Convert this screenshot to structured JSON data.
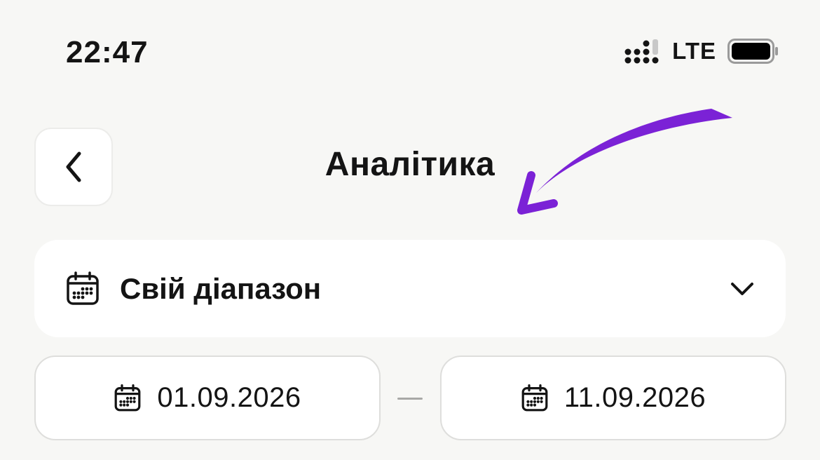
{
  "status_bar": {
    "time": "22:47",
    "network": "LTE",
    "icons": [
      "signal-icon",
      "battery-icon"
    ]
  },
  "header": {
    "title": "Аналітика",
    "back_icon": "chevron-left-icon",
    "annotation": "purple-arrow"
  },
  "range_selector": {
    "label": "Свій діапазон",
    "icon": "calendar-icon",
    "expand_icon": "chevron-down-icon"
  },
  "date_range": {
    "from": "01.09.2026",
    "to": "11.09.2026"
  },
  "colors": {
    "background": "#f7f7f5",
    "card": "#ffffff",
    "text": "#141414",
    "annotation": "#7b22d6"
  }
}
